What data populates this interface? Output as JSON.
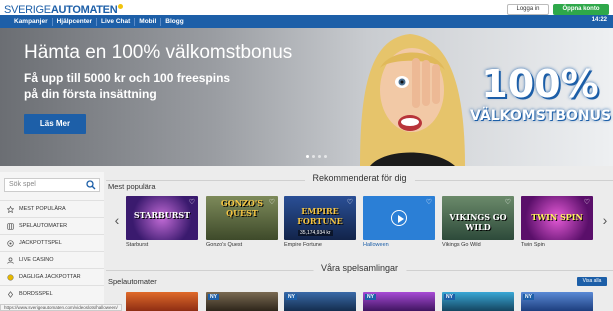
{
  "header": {
    "logo_part1": "SVERIGE",
    "logo_part2": "AUTOMATEN",
    "nav": [
      "Kampanjer",
      "Hjälpcenter",
      "Live Chat",
      "Mobil",
      "Blogg"
    ],
    "login_label": "Logga in",
    "open_account_label": "Öppna konto",
    "clock": "14:22"
  },
  "hero": {
    "title": "Hämta en 100% välkomstbonus",
    "subtitle_line1": "Få upp till 5000 kr och 100 freespins",
    "subtitle_line2": "på din första insättning",
    "button_label": "Läs Mer",
    "badge_pct": "100%",
    "badge_word": "VÄLKOMSTBONUS"
  },
  "sidebar": {
    "search_placeholder": "Sök spel",
    "items": [
      {
        "label": "MEST POPULÄRA",
        "icon": "star-icon"
      },
      {
        "label": "SPELAUTOMATER",
        "icon": "slot-icon"
      },
      {
        "label": "JACKPOTTSPEL",
        "icon": "jackpot-icon"
      },
      {
        "label": "LIVE CASINO",
        "icon": "live-icon"
      },
      {
        "label": "DAGLIGA JACKPOTTAR",
        "icon": "daily-jackpot-icon"
      },
      {
        "label": "BORDSSPEL",
        "icon": "table-games-icon"
      }
    ]
  },
  "main": {
    "recommended_title": "Rekommenderat för dig",
    "popular_label": "Mest populära",
    "collections_title": "Våra spelsamlingar",
    "slots_label": "Spelautomater",
    "see_all": "Visa alla",
    "games": [
      {
        "name": "Starburst",
        "thumb_text": "STARBURST",
        "color": "#3a1a6e"
      },
      {
        "name": "Gonzo's Quest",
        "thumb_text": "GONZO'S QUEST",
        "color": "#3e4a2a"
      },
      {
        "name": "Empire Fortune",
        "thumb_text": "EMPIRE FORTUNE",
        "color": "#1c3466",
        "jackpot": "35,174,934 kr"
      },
      {
        "name": "Halloween",
        "thumb_text": "",
        "color": "#2b7fd6"
      },
      {
        "name": "Vikings Go Wild",
        "thumb_text": "VIKINGS GO WILD",
        "color": "#2d4a3a"
      },
      {
        "name": "Twin Spin",
        "thumb_text": "TWIN SPIN",
        "color": "#7a1d8a"
      }
    ],
    "collection_tiles": [
      {
        "color": "#b33a1a",
        "badge": ""
      },
      {
        "color": "#3a2f22",
        "badge": "NY"
      },
      {
        "color": "#1a3d6a",
        "badge": "NY"
      },
      {
        "color": "#6a2a8a",
        "badge": "NY"
      },
      {
        "color": "#1a6a8a",
        "badge": "NY"
      },
      {
        "color": "#2a5a9a",
        "badge": "NY"
      }
    ]
  },
  "status_bar": "https://www.sverigeautomaten.com/videoslots/halloween/"
}
